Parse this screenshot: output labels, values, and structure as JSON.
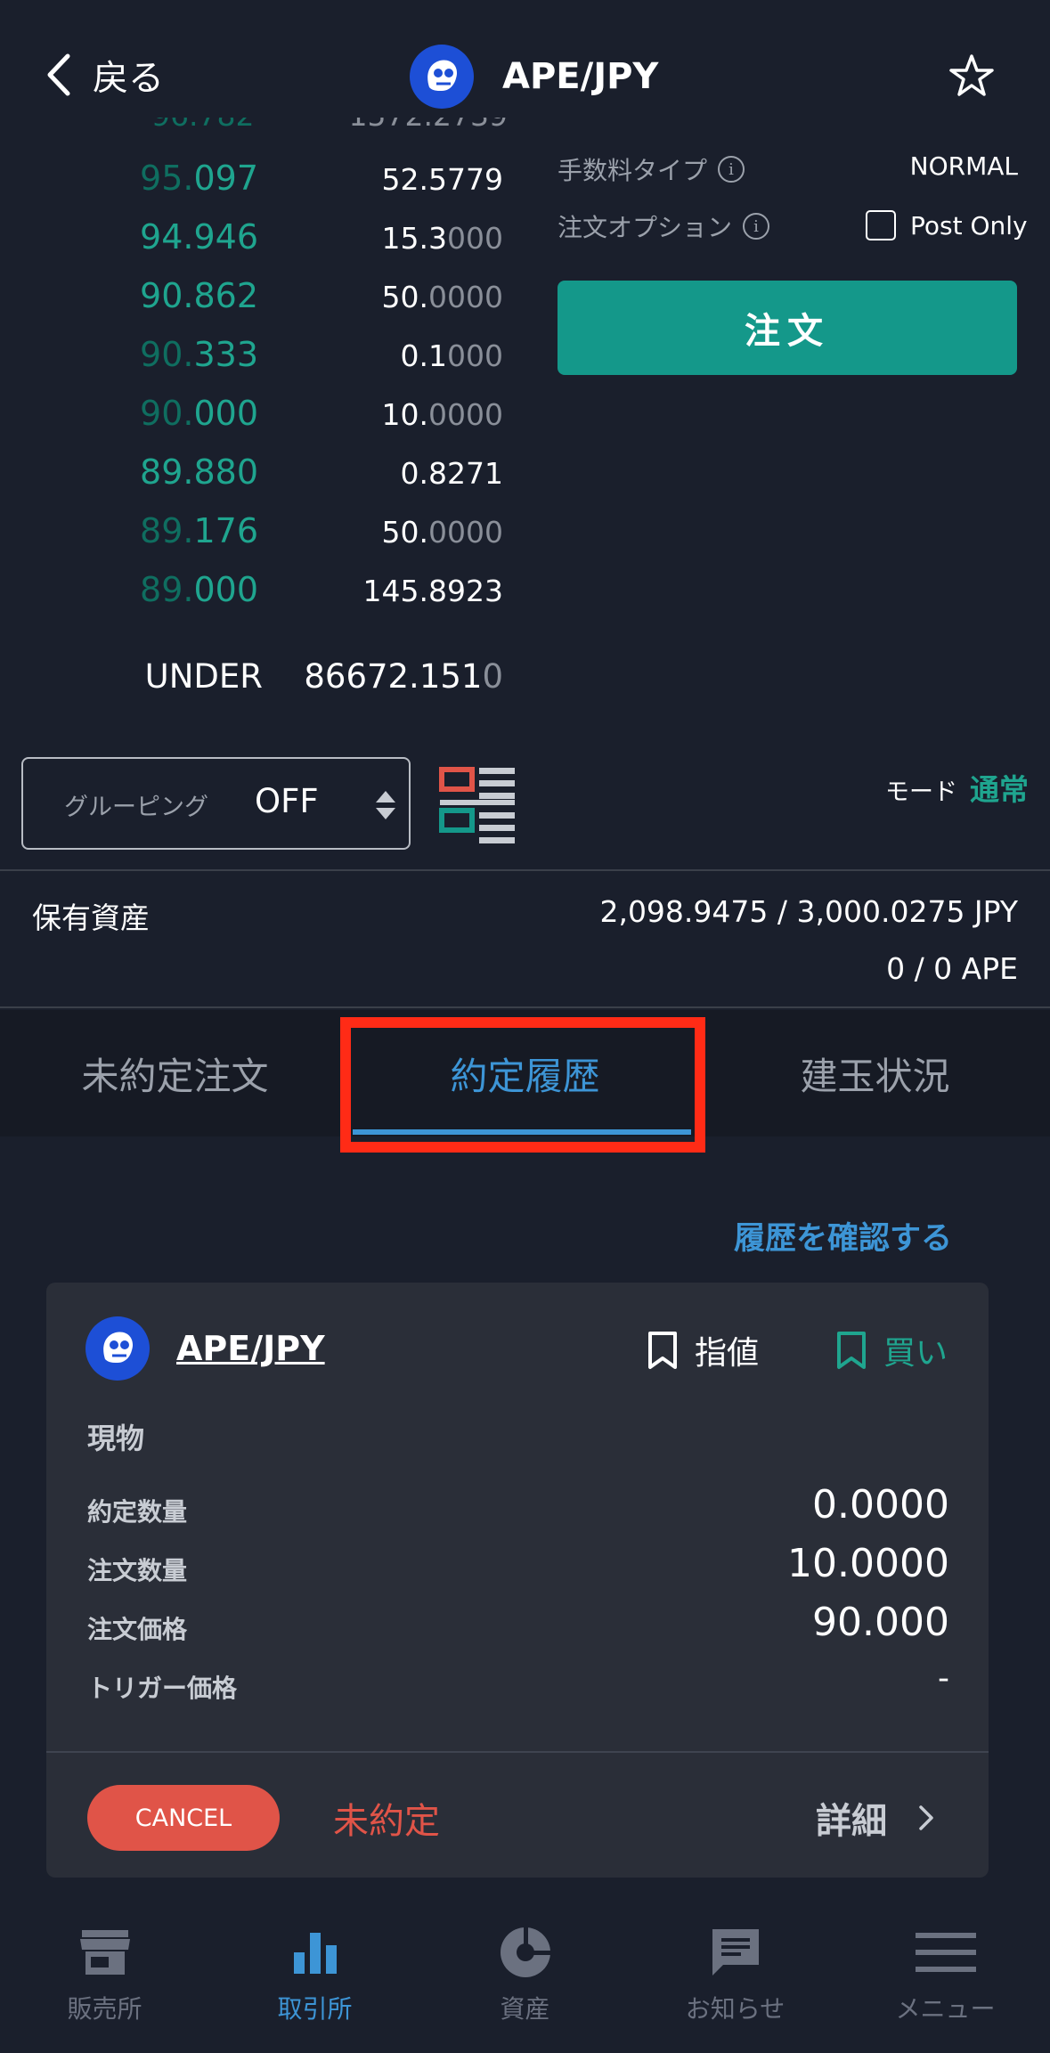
{
  "header": {
    "back_label": "戻る",
    "title": "APE/JPY"
  },
  "orderbook": {
    "rows": [
      {
        "dim": "95.",
        "main": "097",
        "qty_main": "52.5779",
        "qty_dim": ""
      },
      {
        "dim": "",
        "main": "94.946",
        "qty_main": "15.3",
        "qty_dim": "000"
      },
      {
        "dim": "",
        "main": "90.862",
        "qty_main": "50.",
        "qty_dim": "0000"
      },
      {
        "dim": "90.",
        "main": "333",
        "qty_main": "0.1",
        "qty_dim": "000"
      },
      {
        "dim": "90.",
        "main": "000",
        "qty_main": "10.",
        "qty_dim": "0000"
      },
      {
        "dim": "",
        "main": "89.880",
        "qty_main": "0.8271",
        "qty_dim": ""
      },
      {
        "dim": "89.",
        "main": "176",
        "qty_main": "50.",
        "qty_dim": "0000"
      },
      {
        "dim": "89.",
        "main": "000",
        "qty_main": "145.8923",
        "qty_dim": ""
      }
    ],
    "under_label": "UNDER",
    "under_value_main": "86672.151",
    "under_value_dim": "0"
  },
  "order_panel": {
    "fee_type_label": "手数料タイプ",
    "fee_type_value": "NORMAL",
    "option_label": "注文オプション",
    "post_only_label": "Post Only",
    "order_button": "注文"
  },
  "grouping": {
    "label": "グルーピング",
    "value": "OFF"
  },
  "mode": {
    "label": "モード",
    "value": "通常"
  },
  "assets": {
    "label": "保有資産",
    "jpy": "2,098.9475 / 3,000.0275  JPY",
    "ape": "0 / 0  APE"
  },
  "tabs": [
    {
      "label": "未約定注文"
    },
    {
      "label": "約定履歴"
    },
    {
      "label": "建玉状況"
    }
  ],
  "history_link": "履歴を確認する",
  "order_card": {
    "pair": "APE/JPY",
    "order_type": "指値",
    "side": "買い",
    "category": "現物",
    "details": [
      {
        "label": "約定数量",
        "value": "0.0000"
      },
      {
        "label": "注文数量",
        "value": "10.0000"
      },
      {
        "label": "注文価格",
        "value": "90.000"
      },
      {
        "label": "トリガー価格",
        "value": "-"
      }
    ],
    "cancel_label": "CANCEL",
    "status": "未約定",
    "detail_label": "詳細"
  },
  "bottom_nav": [
    {
      "label": "販売所",
      "icon": "store-icon"
    },
    {
      "label": "取引所",
      "icon": "chart-bar-icon"
    },
    {
      "label": "資産",
      "icon": "pie-icon"
    },
    {
      "label": "お知らせ",
      "icon": "message-icon"
    },
    {
      "label": "メニュー",
      "icon": "menu-icon"
    }
  ],
  "colors": {
    "background": "#1a1f2c",
    "accent_green": "#1fa58f",
    "accent_blue": "#3d95d6",
    "danger": "#e05448",
    "highlight": "#ff2b16"
  }
}
